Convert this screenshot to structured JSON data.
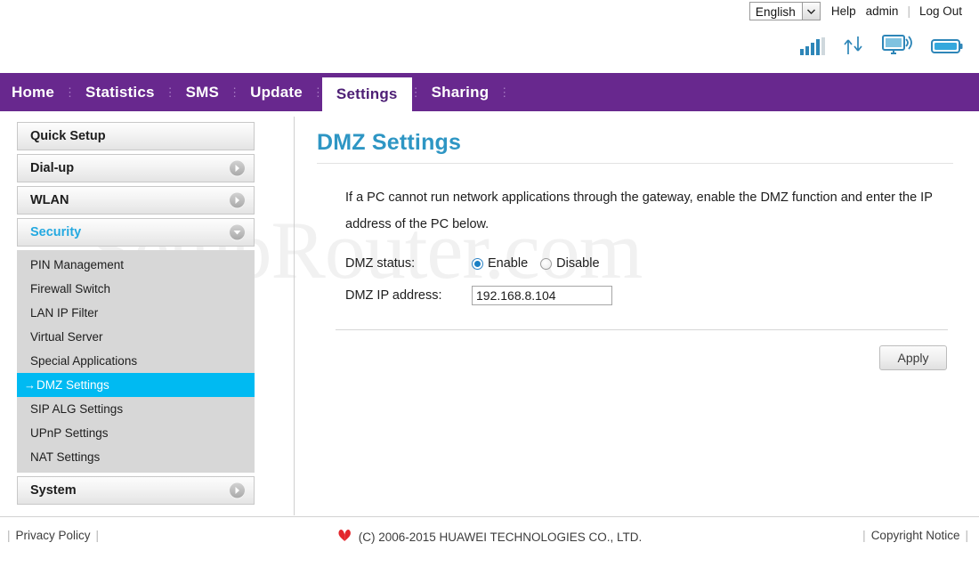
{
  "topbar": {
    "language": {
      "selected": "English",
      "options": [
        "English"
      ],
      "icon": "chevron-down-icon"
    },
    "links": [
      {
        "label": "Help",
        "name": "help-link"
      },
      {
        "label": "admin",
        "name": "account-link"
      },
      {
        "label": "Log Out",
        "name": "logout-link"
      }
    ],
    "status_icons": [
      {
        "name": "signal-strength-icon",
        "label": "Signal strength"
      },
      {
        "name": "data-transfer-icon",
        "label": "Data up/down"
      },
      {
        "name": "connected-device-icon",
        "label": "Connected device"
      },
      {
        "name": "battery-icon",
        "label": "Battery"
      }
    ]
  },
  "nav": {
    "items": [
      {
        "label": "Home",
        "active": false
      },
      {
        "label": "Statistics",
        "active": false
      },
      {
        "label": "SMS",
        "active": false
      },
      {
        "label": "Update",
        "active": false
      },
      {
        "label": "Settings",
        "active": true
      },
      {
        "label": "Sharing",
        "active": false
      }
    ],
    "separator": "⋮"
  },
  "sidebar": {
    "groups": [
      {
        "label": "Quick Setup",
        "state": "plain",
        "chevron": "none"
      },
      {
        "label": "Dial-up",
        "state": "collapsed",
        "chevron": "chevron-right-icon"
      },
      {
        "label": "WLAN",
        "state": "collapsed",
        "chevron": "chevron-right-icon"
      },
      {
        "label": "Security",
        "state": "expanded",
        "chevron": "chevron-down-icon"
      }
    ],
    "security_items": [
      {
        "label": "PIN Management",
        "selected": false
      },
      {
        "label": "Firewall Switch",
        "selected": false
      },
      {
        "label": "LAN IP Filter",
        "selected": false
      },
      {
        "label": "Virtual Server",
        "selected": false
      },
      {
        "label": "Special Applications",
        "selected": false
      },
      {
        "label": "DMZ Settings",
        "selected": true
      },
      {
        "label": "SIP ALG Settings",
        "selected": false
      },
      {
        "label": "UPnP Settings",
        "selected": false
      },
      {
        "label": "NAT Settings",
        "selected": false
      }
    ],
    "selected_arrow": "→",
    "system_group": {
      "label": "System",
      "state": "collapsed",
      "chevron": "chevron-right-icon"
    }
  },
  "main": {
    "title": "DMZ Settings",
    "description": "If a PC cannot run network applications through the gateway, enable the DMZ function and enter the IP address of the PC below.",
    "fields": {
      "dmz_status": {
        "label": "DMZ status:",
        "options": [
          {
            "label": "Enable",
            "checked": true
          },
          {
            "label": "Disable",
            "checked": false
          }
        ]
      },
      "dmz_ip": {
        "label": "DMZ IP address:",
        "value": "192.168.8.104",
        "placeholder": ""
      }
    },
    "apply_label": "Apply"
  },
  "watermark": {
    "text": "SetupRouter.com"
  },
  "footer": {
    "privacy_label": "Privacy Policy",
    "copyright": "(C) 2006-2015 HUAWEI TECHNOLOGIES CO., LTD.",
    "copyright_notice_label": "Copyright Notice",
    "logo_name": "huawei-logo-icon",
    "pipe": "|"
  },
  "colors": {
    "nav_purple": "#68288e",
    "accent_cyan": "#00baf2",
    "title_blue": "#2e96c4",
    "security_blue": "#25a9e0",
    "icon_blue": "#2e86b8",
    "huawei_red": "#e3262c"
  }
}
